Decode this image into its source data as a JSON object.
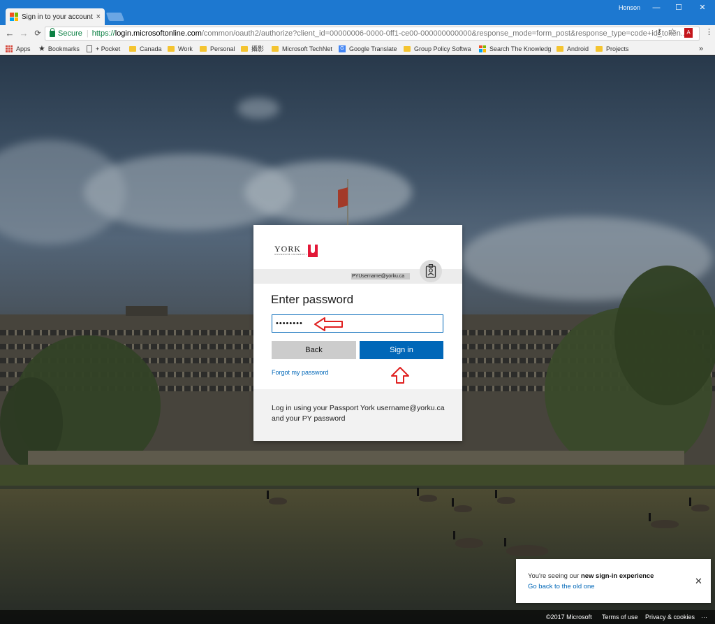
{
  "browser": {
    "tab_title": "Sign in to your account",
    "tab_close": "×",
    "window_user": "Honson",
    "window_controls": {
      "minimize": "—",
      "maximize": "☐",
      "close": "✕"
    },
    "nav": {
      "back": "←",
      "forward": "→",
      "reload": "C"
    },
    "omnibox": {
      "secure_label": "Secure",
      "separator": "|",
      "protocol": "https://",
      "host": "login.microsoftonline.com",
      "path": "/common/oauth2/authorize?client_id=00000006-0000-0ff1-ce00-000000000000&response_mode=form_post&response_type=code+id_token..."
    },
    "icons": {
      "key": "key-icon",
      "star": "star-icon",
      "pdf": "pdf-icon",
      "menu": "kebab-menu-icon"
    },
    "bookmarks": [
      "Apps",
      "Bookmarks",
      "+ Pocket",
      "Canada",
      "Work",
      "Personal",
      "攝影",
      "Microsoft TechNet",
      "Google Translate",
      "Group Policy Softwa",
      "Search The Knowledg",
      "Android",
      "Projects"
    ],
    "bookmarks_overflow": "»"
  },
  "signin": {
    "org_name": "YORK",
    "org_sub": "UNIVERSITÉ UNIVERSITY",
    "identity": "PYUsername@yorku.ca",
    "heading": "Enter password",
    "password_masked": "••••••••",
    "back_label": "Back",
    "signin_label": "Sign in",
    "forgot_label": "Forgot my password",
    "footer_text": "Log in using your Passport York username@yorku.ca and your PY password"
  },
  "notice": {
    "prefix": "You're seeing our ",
    "bold": "new sign-in experience",
    "link": "Go back to the old one",
    "close": "✕"
  },
  "page_footer": {
    "copyright": "©2017 Microsoft",
    "terms": "Terms of use",
    "privacy": "Privacy & cookies",
    "more": "···"
  },
  "colors": {
    "chrome_blue": "#1d78d0",
    "accent": "#0067b8",
    "annotation_red": "#e02020",
    "york_red": "#e31837"
  }
}
